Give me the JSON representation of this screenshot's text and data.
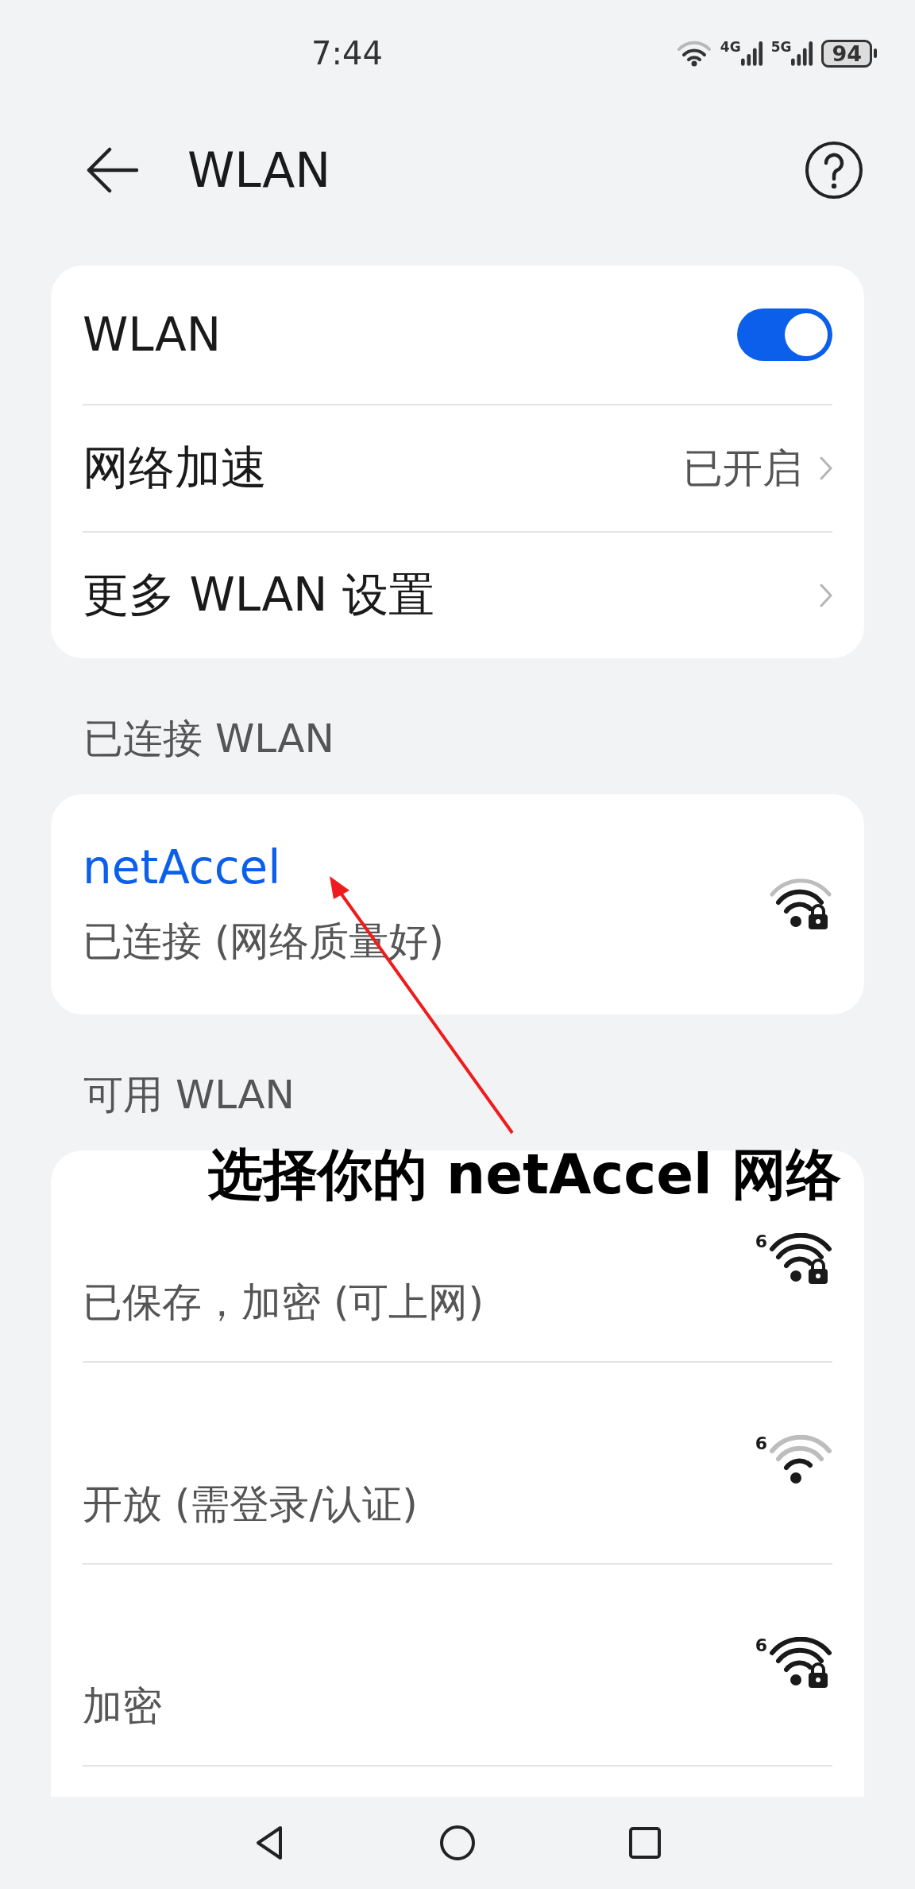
{
  "status_bar": {
    "time": "7:44",
    "cellular": [
      "4G",
      "5G"
    ],
    "battery": "94"
  },
  "header": {
    "title": "WLAN"
  },
  "settings": [
    {
      "kind": "toggle",
      "label": "WLAN",
      "on": true
    },
    {
      "kind": "link",
      "label": "网络加速",
      "value": "已开启"
    },
    {
      "kind": "link",
      "label": "更多 WLAN 设置"
    }
  ],
  "connected": {
    "heading": "已连接 WLAN",
    "networks": [
      {
        "name": "netAccel",
        "status": "已连接 (网络质量好)",
        "locked": true
      }
    ]
  },
  "available": {
    "heading": "可用 WLAN",
    "networks": [
      {
        "status": "已保存，加密 (可上网)",
        "locked": true,
        "band": "6"
      },
      {
        "status": "开放 (需登录/认证)",
        "locked": false,
        "band": "6"
      },
      {
        "status": "加密",
        "locked": true,
        "band": "6"
      }
    ]
  },
  "annotation": {
    "text": "选择你的 netAccel 网络"
  }
}
